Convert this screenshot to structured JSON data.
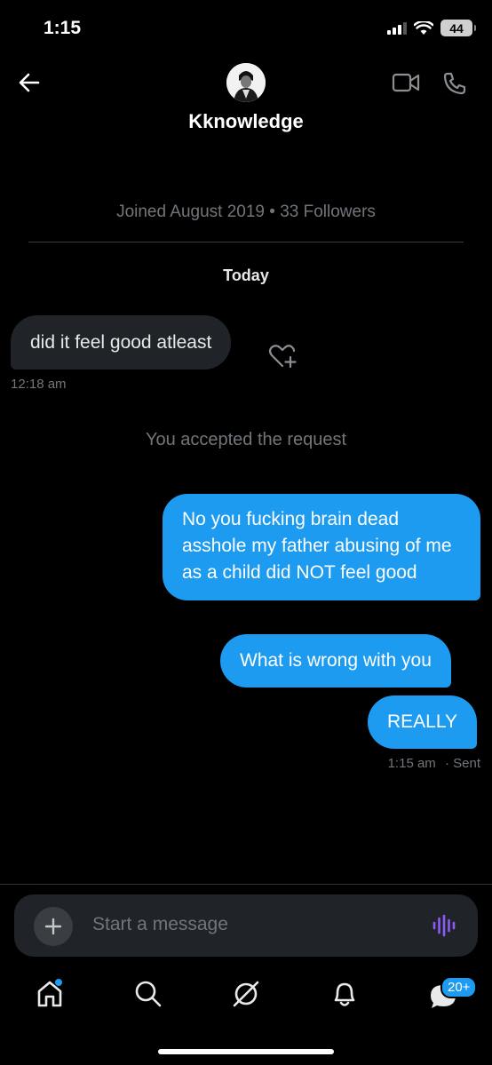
{
  "status_bar": {
    "time": "1:15",
    "battery": "44"
  },
  "header": {
    "username": "Kknowledge",
    "joined": "Joined August 2019",
    "separator": "•",
    "followers": "33 Followers"
  },
  "date_divider": "Today",
  "messages": {
    "incoming": {
      "text": "did it feel good atleast",
      "time": "12:18 am"
    },
    "system": "You accepted the request",
    "outgoing": [
      {
        "text": "No you fucking brain dead asshole my father abusing of me as a child did NOT feel good"
      },
      {
        "text": "What is wrong with you"
      },
      {
        "text": "REALLY"
      }
    ],
    "outgoing_time": "1:15 am",
    "outgoing_status": "· Sent"
  },
  "composer": {
    "placeholder": "Start a message"
  },
  "tab_bar": {
    "messages_badge": "20+"
  },
  "colors": {
    "accent": "#1d9bf0",
    "bubble_in": "#202327",
    "background": "#000000",
    "muted": "#71767b"
  },
  "icons": [
    "back-arrow-icon",
    "video-call-icon",
    "phone-icon",
    "heart-plus-icon",
    "plus-icon",
    "voice-wave-icon",
    "home-icon",
    "search-icon",
    "grok-icon",
    "bell-icon",
    "messages-icon"
  ]
}
